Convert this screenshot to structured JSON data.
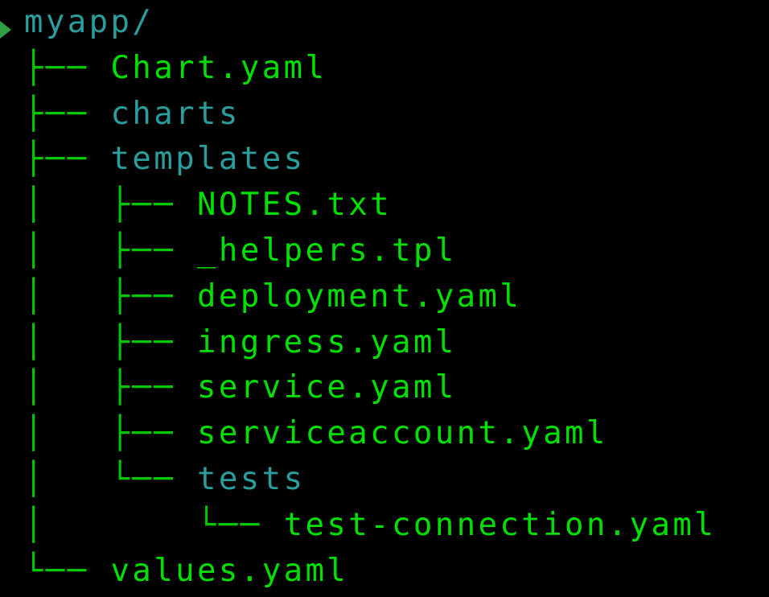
{
  "colors": {
    "background": "#000000",
    "file": "#00e000",
    "directory": "#2a9d9d",
    "branch": "#00c800"
  },
  "tree": [
    {
      "prefix": "",
      "name": "myapp/",
      "type": "dir"
    },
    {
      "prefix": "├── ",
      "name": "Chart.yaml",
      "type": "file"
    },
    {
      "prefix": "├── ",
      "name": "charts",
      "type": "dir"
    },
    {
      "prefix": "├── ",
      "name": "templates",
      "type": "dir"
    },
    {
      "prefix": "│   ├── ",
      "name": "NOTES.txt",
      "type": "file"
    },
    {
      "prefix": "│   ├── ",
      "name": "_helpers.tpl",
      "type": "file"
    },
    {
      "prefix": "│   ├── ",
      "name": "deployment.yaml",
      "type": "file"
    },
    {
      "prefix": "│   ├── ",
      "name": "ingress.yaml",
      "type": "file"
    },
    {
      "prefix": "│   ├── ",
      "name": "service.yaml",
      "type": "file"
    },
    {
      "prefix": "│   ├── ",
      "name": "serviceaccount.yaml",
      "type": "file"
    },
    {
      "prefix": "│   └── ",
      "name": "tests",
      "type": "dir"
    },
    {
      "prefix": "│       └── ",
      "name": "test-connection.yaml",
      "type": "file"
    },
    {
      "prefix": "└── ",
      "name": "values.yaml",
      "type": "file"
    }
  ]
}
